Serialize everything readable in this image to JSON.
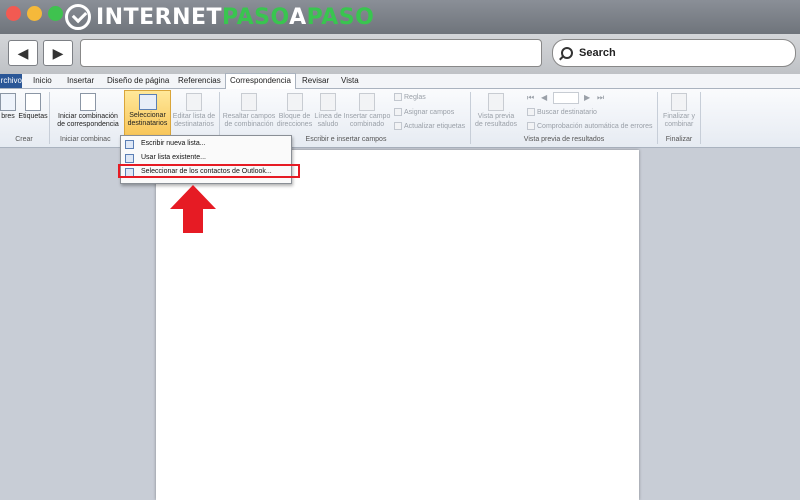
{
  "brand": {
    "part1": "INTERNET",
    "part2": "PASO",
    "part3": "A",
    "part4": "PASO"
  },
  "browser": {
    "back": "◀",
    "forward": "▶",
    "search_placeholder": "Search"
  },
  "ribbon_tabs": [
    "rchivo",
    "Inicio",
    "Insertar",
    "Diseño de página",
    "Referencias",
    "Correspondencia",
    "Revisar",
    "Vista"
  ],
  "ribbon": {
    "sobres": "bres",
    "etiquetas": "Etiquetas",
    "crear": "Crear",
    "iniciar_l1": "Iniciar combinación",
    "iniciar_l2": "de correspondencia",
    "iniciar_group": "Iniciar combinac",
    "sel_l1": "Seleccionar",
    "sel_l2": "destinatarios",
    "editar_l1": "Editar lista de",
    "editar_l2": "destinatarios",
    "resaltar_l1": "Resaltar campos",
    "resaltar_l2": "de combinación",
    "bloque_l1": "Bloque de",
    "bloque_l2": "direcciones",
    "linea_l1": "Línea de",
    "linea_l2": "saludo",
    "insertar_l1": "Insertar campo",
    "insertar_l2": "combinado",
    "reglas": "Reglas",
    "asignar": "Asignar campos",
    "actualizar": "Actualizar etiquetas",
    "escribir_group": "Escribir e insertar campos",
    "vista_l1": "Vista previa",
    "vista_l2": "de resultados",
    "buscar": "Buscar destinatario",
    "comprobacion": "Comprobación automática de errores",
    "vista_group": "Vista previa de resultados",
    "finalizar_l1": "Finalizar y",
    "finalizar_l2": "combinar",
    "finalizar_group": "Finalizar"
  },
  "dropdown": {
    "item1": "Escribir nueva lista...",
    "item2": "Usar lista existente...",
    "item3": "Seleccionar de los contactos de Outlook..."
  },
  "colors": {
    "highlight": "#e61b24",
    "arrow": "#e61b24",
    "brand_green": "#39c54f"
  }
}
